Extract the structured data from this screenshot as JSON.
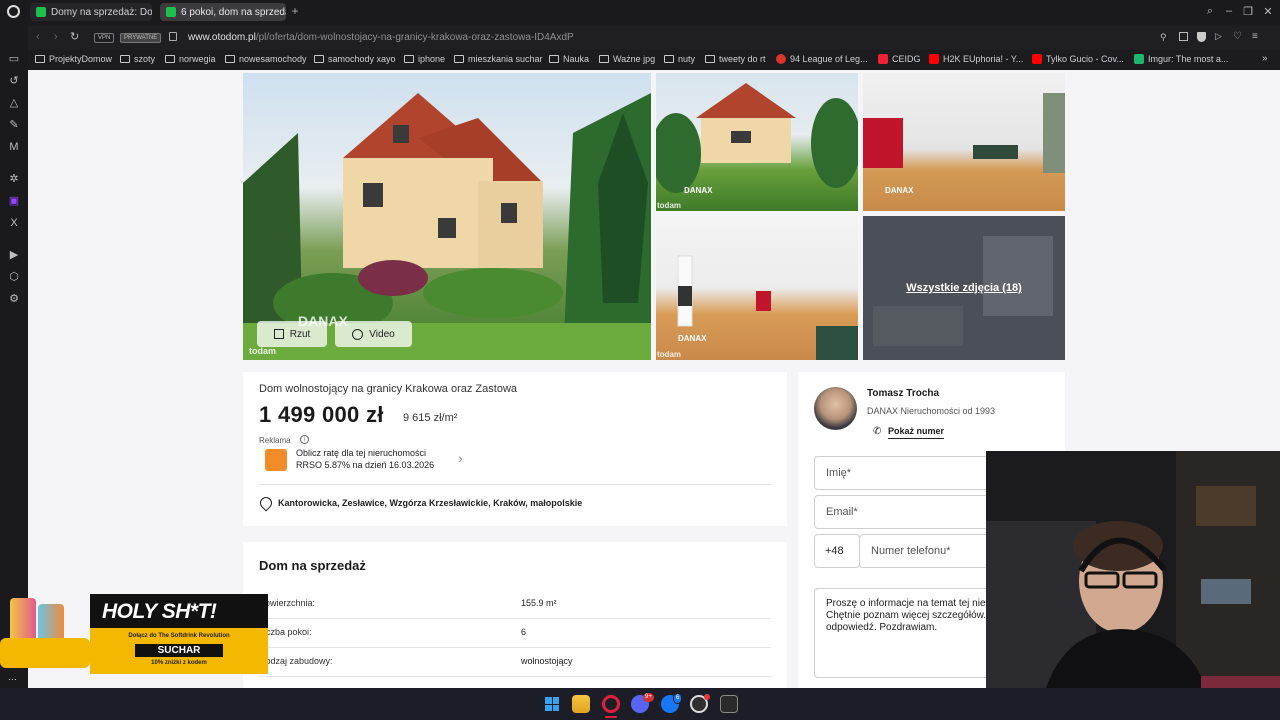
{
  "browser": {
    "tabs": [
      {
        "label": "Domy na sprzedaż: Dojazd"
      },
      {
        "label": "6 pokoi, dom na sprzedaż"
      }
    ],
    "url_domain": "www.otodom.pl",
    "url_path": "/pl/oferta/dom-wolnostojacy-na-granicy-krakowa-oraz-zastowa-ID4AxdP",
    "vpn_badge": "VPN",
    "private_badge": "PRYWATNE",
    "bookmarks": [
      "ProjektyDomow",
      "szoty",
      "norwegia",
      "nowesamochody",
      "samochody xayo",
      "iphone",
      "mieszkania suchar",
      "Nauka",
      "Ważne jpg",
      "nuty",
      "tweety do rt",
      "94 League of Leg...",
      "CEIDG",
      "H2K EUphoria! - Y...",
      "Tylko Gucio - Cov...",
      "Imgur: The most a..."
    ]
  },
  "gallery": {
    "watermark_brand": "DANAX",
    "watermark_site": "todam",
    "plan_button": "Rzut",
    "video_button": "Video",
    "all_photos": "Wszystkie zdjęcia (18)"
  },
  "listing": {
    "title": "Dom wolnostojący na granicy Krakowa oraz Zastowa",
    "price": "1 499 000 zł",
    "price_per_m2": "9 615 zł/m²",
    "ad_label": "Reklama",
    "loan_line1": "Oblicz ratę dla tej nieruchomości",
    "loan_line2": "RRSO 5.87% na dzień 16.03.2026",
    "location": "Kantorowicka, Zesławice, Wzgórza Krzesławickie, Kraków, małopolskie"
  },
  "details": {
    "heading": "Dom na sprzedaż",
    "rows": [
      {
        "key": "Powierzchnia:",
        "value": "155.9 m²"
      },
      {
        "key": "Liczba pokoi:",
        "value": "6"
      },
      {
        "key": "Rodzaj zabudowy:",
        "value": "wolnostojący"
      }
    ]
  },
  "agent": {
    "name": "Tomasz Trocha",
    "agency": "DANAX Nieruchomości od 1993",
    "show_number": "Pokaż numer",
    "name_placeholder": "Imię*",
    "email_placeholder": "Email*",
    "country_code": "+48",
    "phone_placeholder": "Numer telefonu*",
    "message": "Proszę o informacje na temat tej nieruchomości. Chętnie poznam więcej szczegółów. Czekam na odpowiedź. Pozdrawiam."
  },
  "promo": {
    "headline": "HOLY SH*T!",
    "sub": "Dołącz do The Softdrink Revolution",
    "brand": "SUCHAR",
    "discount": "10% zniżki z kodem"
  },
  "taskbar": {
    "badge_discord": "9+",
    "badge_facebook": "6"
  },
  "colors": {
    "price": "#1a1a1a",
    "tab_favicon": "#1fbf4e",
    "loan_icon": "#f28c28",
    "promo_bg": "#f5b800",
    "page_bg": "#f5f5f7"
  }
}
